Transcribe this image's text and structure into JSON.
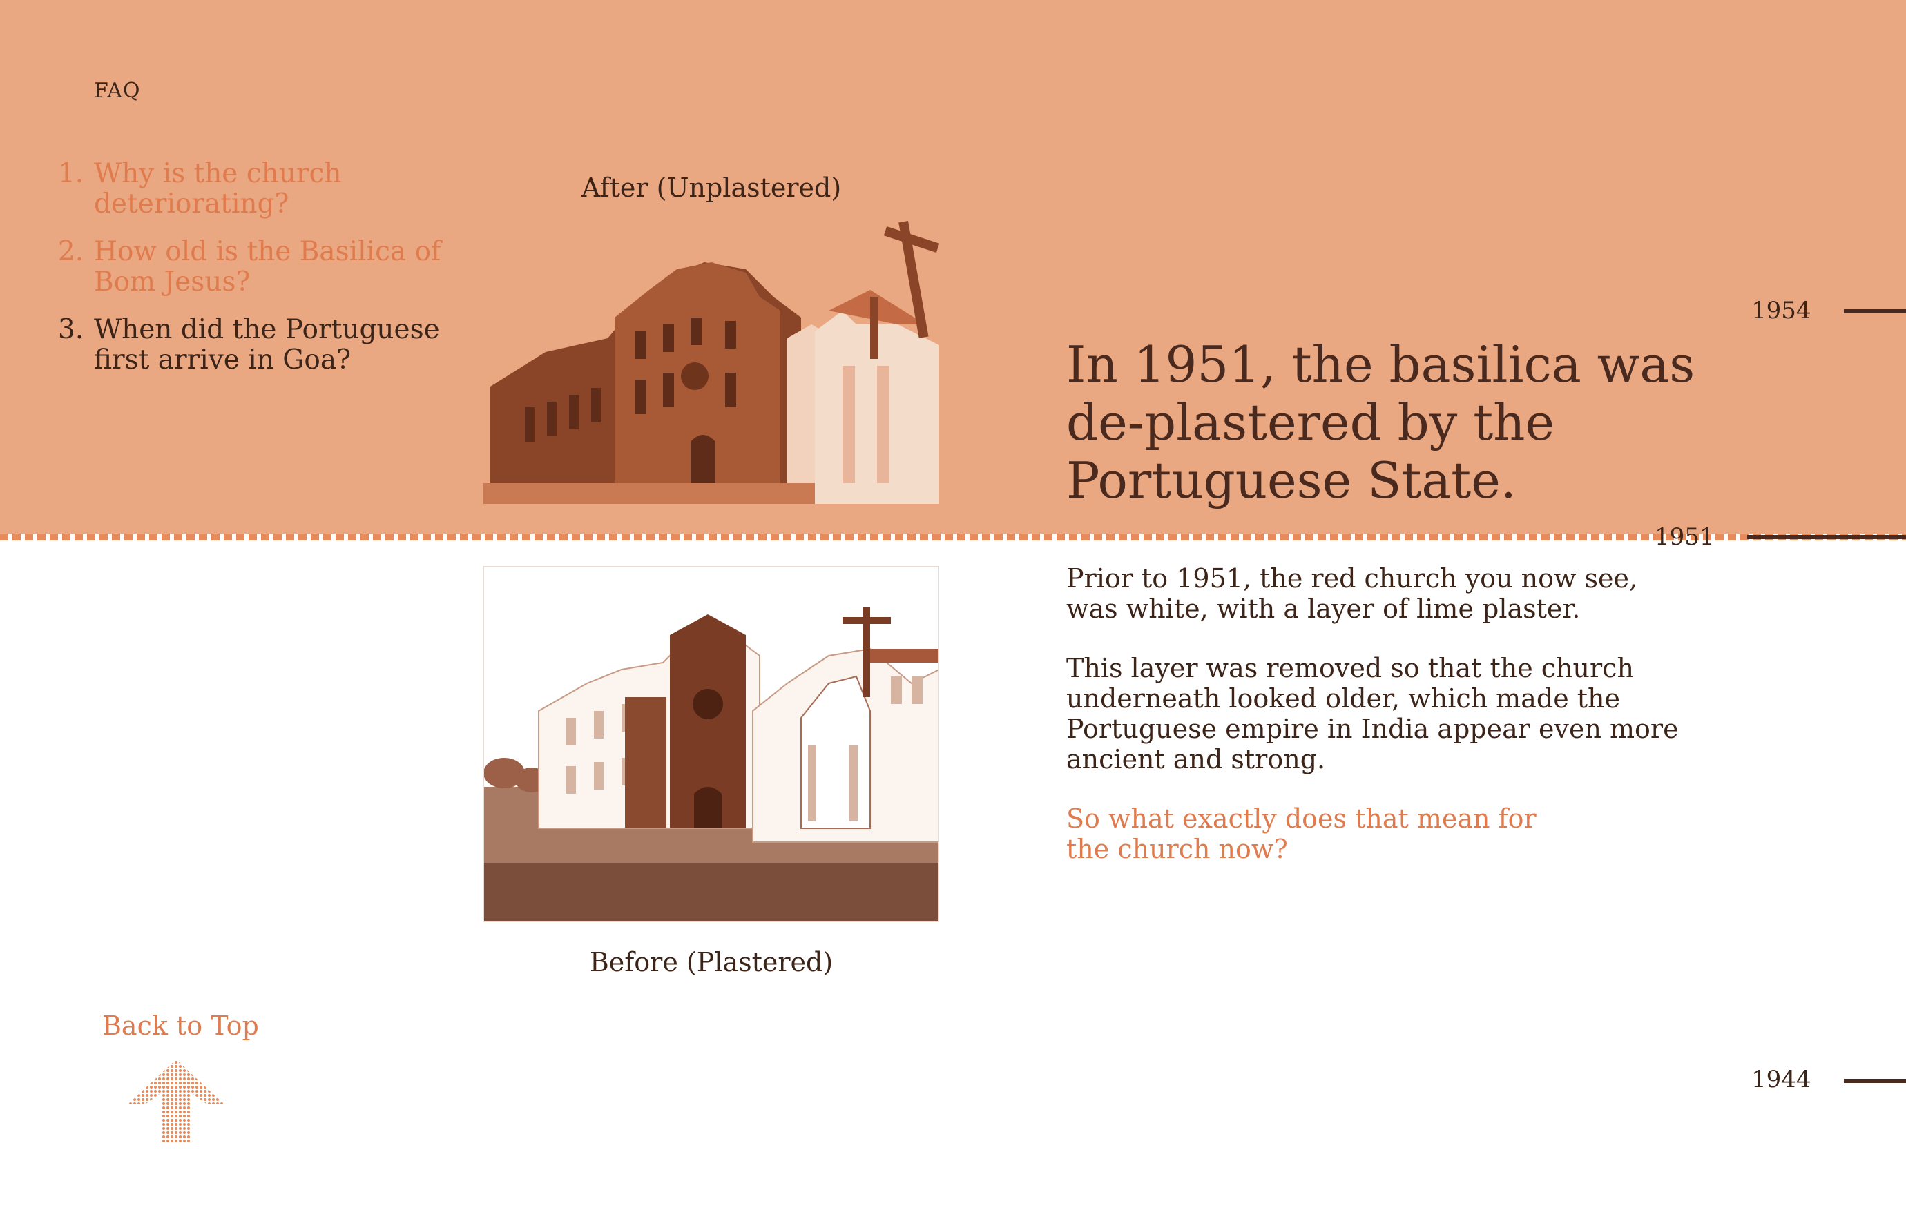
{
  "nav": {
    "faq_label": "FAQ"
  },
  "faq": {
    "items": [
      {
        "num": "1.",
        "text": "Why is the church deteriorating?"
      },
      {
        "num": "2.",
        "text": "How old is the Basilica of Bom Jesus?"
      },
      {
        "num": "3.",
        "text": "When did the Portuguese first arrive in Goa?"
      }
    ]
  },
  "images": {
    "after_caption": "After (Unplastered)",
    "before_caption": "Before (Plastered)"
  },
  "article": {
    "headline": "In 1951, the basilica was de-plastered by the Portuguese State.",
    "paragraph_1": "Prior to 1951, the red church you now see, was white, with a layer of lime plaster.",
    "paragraph_2": "This layer was removed so that the church underneath looked older, which made the Portuguese empire in India appear even more ancient and strong.",
    "cta": "So what exactly does that mean for the church now?"
  },
  "timeline": {
    "year_top": "1954",
    "year_mid": "1951",
    "year_bottom": "1944"
  },
  "footer": {
    "back_to_top": "Back to Top"
  },
  "colors": {
    "band": "#eaa882",
    "accent": "#e07b4e",
    "text_dark": "#3c2418"
  }
}
